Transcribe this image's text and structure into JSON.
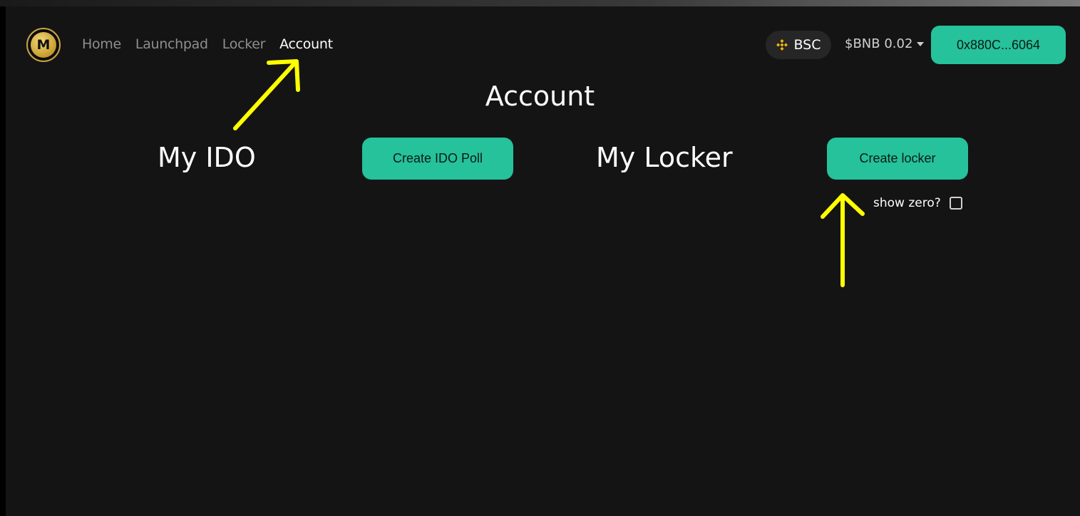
{
  "nav": {
    "logo_letter": "M",
    "items": [
      {
        "label": "Home",
        "active": false
      },
      {
        "label": "Launchpad",
        "active": false
      },
      {
        "label": "Locker",
        "active": false
      },
      {
        "label": "Account",
        "active": true
      }
    ]
  },
  "header": {
    "network": {
      "label": "BSC",
      "icon": "bnb-icon"
    },
    "balance": "$BNB 0.02",
    "wallet": "0x880C...6064"
  },
  "main": {
    "title": "Account",
    "ido": {
      "heading": "My IDO",
      "button": "Create IDO Poll"
    },
    "locker": {
      "heading": "My Locker",
      "button": "Create locker",
      "show_zero_label": "show zero?",
      "show_zero_checked": false
    }
  },
  "colors": {
    "accent": "#25c29b",
    "background": "#141414",
    "annotation": "#ffff00",
    "logo_gold": "#c9a445"
  }
}
